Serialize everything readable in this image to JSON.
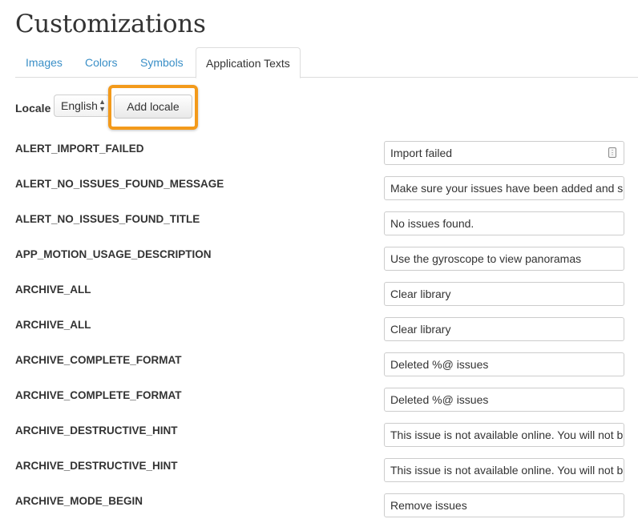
{
  "page": {
    "title": "Customizations"
  },
  "tabs": [
    {
      "label": "Images"
    },
    {
      "label": "Colors"
    },
    {
      "label": "Symbols"
    },
    {
      "label": "Application Texts",
      "active": true
    }
  ],
  "locale": {
    "label": "Locale",
    "selected": "English",
    "add_button": "Add locale"
  },
  "accent_colors": {
    "link": "#3a8fc7",
    "highlight": "#f39a1b"
  },
  "rows": [
    {
      "key": "ALERT_IMPORT_FAILED",
      "value": "Import failed"
    },
    {
      "key": "ALERT_NO_ISSUES_FOUND_MESSAGE",
      "value": "Make sure your issues have been added and s"
    },
    {
      "key": "ALERT_NO_ISSUES_FOUND_TITLE",
      "value": "No issues found."
    },
    {
      "key": "APP_MOTION_USAGE_DESCRIPTION",
      "value": "Use the gyroscope to view panoramas"
    },
    {
      "key": "ARCHIVE_ALL",
      "value": "Clear library"
    },
    {
      "key": "ARCHIVE_ALL",
      "value": "Clear library"
    },
    {
      "key": "ARCHIVE_COMPLETE_FORMAT",
      "value": "Deleted %@ issues"
    },
    {
      "key": "ARCHIVE_COMPLETE_FORMAT",
      "value": "Deleted %@ issues"
    },
    {
      "key": "ARCHIVE_DESTRUCTIVE_HINT",
      "value": "This issue is not available online. You will not b"
    },
    {
      "key": "ARCHIVE_DESTRUCTIVE_HINT",
      "value": "This issue is not available online. You will not b"
    },
    {
      "key": "ARCHIVE_MODE_BEGIN",
      "value": "Remove issues"
    }
  ]
}
